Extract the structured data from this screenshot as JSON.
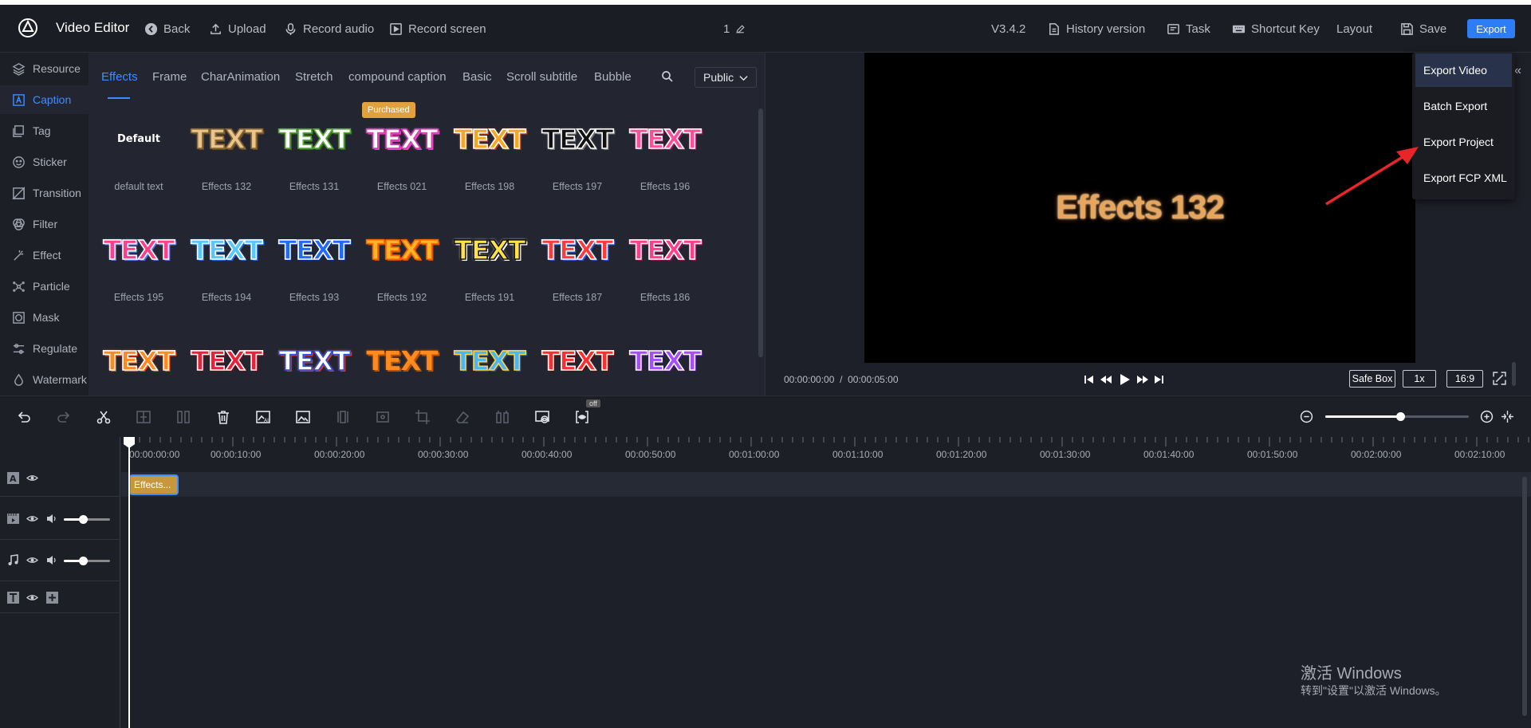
{
  "topbar": {
    "app_title": "Video Editor",
    "back": "Back",
    "upload": "Upload",
    "record_audio": "Record audio",
    "record_screen": "Record screen",
    "project_name": "1",
    "version": "V3.4.2",
    "history_version": "History version",
    "task": "Task",
    "shortcut_key": "Shortcut Key",
    "layout": "Layout",
    "save": "Save",
    "export": "Export"
  },
  "sidebar": {
    "items": [
      {
        "label": "Resource",
        "icon": "layers-icon"
      },
      {
        "label": "Caption",
        "icon": "caption-icon",
        "active": true
      },
      {
        "label": "Tag",
        "icon": "tag-icon"
      },
      {
        "label": "Sticker",
        "icon": "sticker-icon"
      },
      {
        "label": "Transition",
        "icon": "transition-icon"
      },
      {
        "label": "Filter",
        "icon": "filter-icon"
      },
      {
        "label": "Effect",
        "icon": "effect-icon"
      },
      {
        "label": "Particle",
        "icon": "particle-icon"
      },
      {
        "label": "Mask",
        "icon": "mask-icon"
      },
      {
        "label": "Regulate",
        "icon": "sliders-icon"
      },
      {
        "label": "Watermark",
        "icon": "drop-icon"
      }
    ]
  },
  "panel": {
    "tabs": [
      "Effects",
      "Frame",
      "CharAnimation",
      "Stretch",
      "compound caption",
      "Basic",
      "Scroll subtitle",
      "Bubble"
    ],
    "active_tab": "Effects",
    "filter_select": "Public",
    "purchased_badge": "Purchased",
    "effects": [
      {
        "label": "default text",
        "thumb": "Default",
        "fill": "#ffffff",
        "stroke": "none",
        "glow": "none"
      },
      {
        "label": "Effects 132",
        "thumb": "TEXT",
        "fill": "#e9c58b",
        "stroke": "#8a6a3a",
        "glow": "#6b4a20"
      },
      {
        "label": "Effects 131",
        "thumb": "TEXT",
        "fill": "#ffffff",
        "stroke": "#5aa63c",
        "glow": "#2f6b1c"
      },
      {
        "label": "Effects 021",
        "thumb": "TEXT",
        "fill": "#ffffff",
        "stroke": "#d13fb0",
        "glow": "#ff3fd0",
        "purchased": true
      },
      {
        "label": "Effects 198",
        "thumb": "TEXT",
        "fill": "#f5a623",
        "stroke": "#ffffff",
        "glow": "#c43b12"
      },
      {
        "label": "Effects 197",
        "thumb": "TEXT",
        "fill": "#111111",
        "stroke": "#ffffff",
        "glow": "#777777"
      },
      {
        "label": "Effects 196",
        "thumb": "TEXT",
        "fill": "#ff4f9b",
        "stroke": "#ffffff",
        "glow": "#a0165a"
      },
      {
        "label": "Effects 195",
        "thumb": "TEXT",
        "fill": "#ff3f8a",
        "stroke": "#ffffff",
        "glow": "#5a6ee0"
      },
      {
        "label": "Effects 194",
        "thumb": "TEXT",
        "fill": "#56c8ff",
        "stroke": "#ffffff",
        "glow": "#1f69d8"
      },
      {
        "label": "Effects 193",
        "thumb": "TEXT",
        "fill": "#1f6bff",
        "stroke": "#ffffff",
        "glow": "#0a2d8c"
      },
      {
        "label": "Effects 192",
        "thumb": "TEXT",
        "fill": "#ffb52a",
        "stroke": "#ff6a00",
        "glow": "#c94a00"
      },
      {
        "label": "Effects 191",
        "thumb": "TEXT",
        "fill": "#ffe14a",
        "stroke": "#111111",
        "glow": "#ffffff"
      },
      {
        "label": "Effects 187",
        "thumb": "TEXT",
        "fill": "#ff3b3b",
        "stroke": "#ffffff",
        "glow": "#2a55d8"
      },
      {
        "label": "Effects 186",
        "thumb": "TEXT",
        "fill": "#ff3f8a",
        "stroke": "#ffffff",
        "glow": "#8f1252"
      },
      {
        "label": "",
        "thumb": "TEXT",
        "fill": "#ff8a1f",
        "stroke": "#ffffff",
        "glow": "#ff4a00"
      },
      {
        "label": "",
        "thumb": "TEXT",
        "fill": "#e8223a",
        "stroke": "#ffffff",
        "glow": "#7a0a16"
      },
      {
        "label": "",
        "thumb": "TEXT",
        "fill": "#ffffff",
        "stroke": "#2a4fd8",
        "glow": "#d8342a"
      },
      {
        "label": "",
        "thumb": "TEXT",
        "fill": "#ff8a1f",
        "stroke": "none",
        "glow": "#b85400"
      },
      {
        "label": "",
        "thumb": "TEXT",
        "fill": "#45b6ff",
        "stroke": "#ffd23f",
        "glow": "#1a4fa0"
      },
      {
        "label": "",
        "thumb": "TEXT",
        "fill": "#ff2e2e",
        "stroke": "#ffffff",
        "glow": "#7a0000"
      },
      {
        "label": "",
        "thumb": "TEXT",
        "fill": "#a64dff",
        "stroke": "#ffffff",
        "glow": "#4a0f9c"
      }
    ]
  },
  "preview": {
    "overlay_text": "Effects 132",
    "current_time": "00:00:00:00",
    "total_time": "00:00:05:00",
    "safe_box": "Safe Box",
    "speed": "1x",
    "aspect": "16:9"
  },
  "export_menu": {
    "items": [
      "Export Video",
      "Batch Export",
      "Export Project",
      "Export FCP XML"
    ]
  },
  "timeline": {
    "off_label": "off",
    "zoom_level": 0.52,
    "ruler_labels": [
      "00:00:00:00",
      "00:00:10:00",
      "00:00:20:00",
      "00:00:30:00",
      "00:00:40:00",
      "00:00:50:00",
      "00:01:00:00",
      "00:01:10:00",
      "00:01:20:00",
      "00:01:30:00",
      "00:01:40:00",
      "00:01:50:00",
      "00:02:00:00",
      "00:02:10:00"
    ],
    "clip_label": "Effects...",
    "video_volume": 0.42,
    "audio_volume": 0.42
  },
  "watermark": {
    "title": "激活 Windows",
    "subtitle": "转到\"设置\"以激活 Windows。"
  },
  "colors": {
    "accent": "#3f8cff",
    "export_button": "#2d7df6",
    "clip": "#c6973c",
    "badge": "#e0a13e"
  }
}
